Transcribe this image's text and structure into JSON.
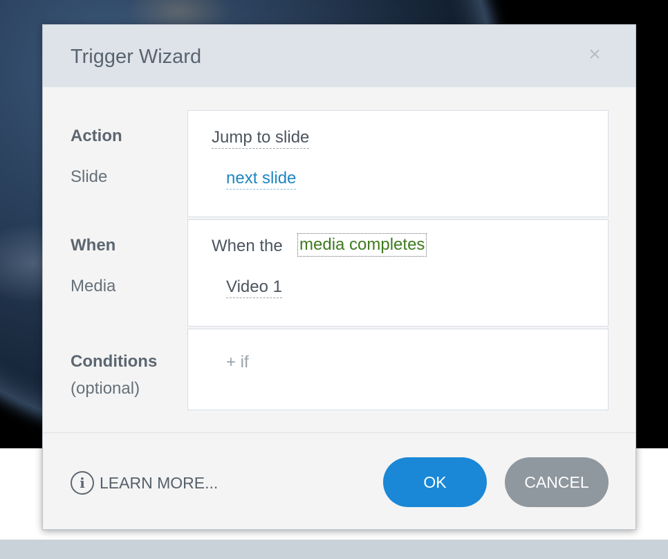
{
  "dialog": {
    "title": "Trigger Wizard",
    "close_icon": "×"
  },
  "action": {
    "label": "Action",
    "value": "Jump to slide",
    "slide_label": "Slide",
    "slide_value": "next slide"
  },
  "when": {
    "label": "When",
    "prefix": "When the",
    "value": "media completes",
    "media_label": "Media",
    "media_value": "Video 1"
  },
  "conditions": {
    "label": "Conditions",
    "sub_label": "(optional)",
    "add_if": "+ if"
  },
  "footer": {
    "info_icon": "i",
    "learn_more": "LEARN MORE...",
    "ok": "OK",
    "cancel": "CANCEL"
  },
  "colors": {
    "ok_button": "#1a88d6",
    "cancel_button": "#8f979f",
    "link": "#1f86c1",
    "event_value": "#3f7a1f"
  }
}
